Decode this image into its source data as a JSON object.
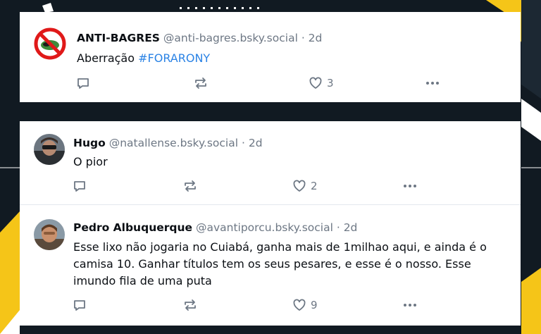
{
  "posts": [
    {
      "name": "ANTI-BAGRES",
      "handle": "@anti-bagres.bsky.social",
      "time": "· 2d",
      "text_plain": "Aberração ",
      "hashtag": "#FORARONY",
      "likes": "3",
      "avatar_icon": "no-catfish-icon"
    },
    {
      "name": "Hugo",
      "handle": "@natallense.bsky.social",
      "time": "· 2d",
      "text": "O pior",
      "likes": "2",
      "avatar_icon": "user-photo"
    },
    {
      "name": "Pedro Albuquerque",
      "handle": "@avantiporcu.bsky.social",
      "time": "· 2d",
      "text": "Esse lixo não jogaria no Cuiabá, ganha mais de 1milhao aqui, e ainda é o camisa 10. Ganhar títulos tem os seus pesares, e esse é o nosso. Esse imundo fila de uma puta",
      "likes": "9",
      "avatar_icon": "user-photo"
    }
  ],
  "colors": {
    "accent": "#2b83e5",
    "text": "#0b0f14",
    "muted": "#6d7784",
    "background": "#111a22",
    "stripe": "#f5c518"
  }
}
